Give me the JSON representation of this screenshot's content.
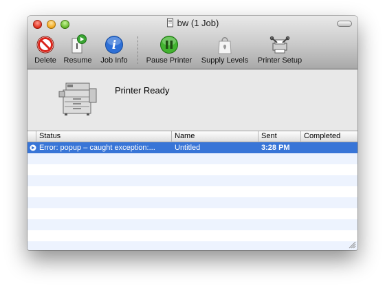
{
  "window": {
    "title": "bw (1 Job)"
  },
  "toolbar": {
    "items": [
      {
        "label": "Delete",
        "icon": "delete-icon"
      },
      {
        "label": "Resume",
        "icon": "resume-icon"
      },
      {
        "label": "Job Info",
        "icon": "info-icon"
      },
      {
        "label": "Pause Printer",
        "icon": "pause-icon"
      },
      {
        "label": "Supply Levels",
        "icon": "supply-levels-icon"
      },
      {
        "label": "Printer Setup",
        "icon": "printer-setup-icon"
      }
    ]
  },
  "printer": {
    "status": "Printer Ready",
    "icon": "printer-icon"
  },
  "jobs": {
    "columns": [
      "Status",
      "Name",
      "Sent",
      "Completed"
    ],
    "rows": [
      {
        "status": "Error: popup – caught exception:...",
        "name": "Untitled",
        "sent": "3:28 PM",
        "completed": ""
      }
    ]
  },
  "colors": {
    "selection": "#3875d7",
    "stripe": "#edf3fe"
  }
}
